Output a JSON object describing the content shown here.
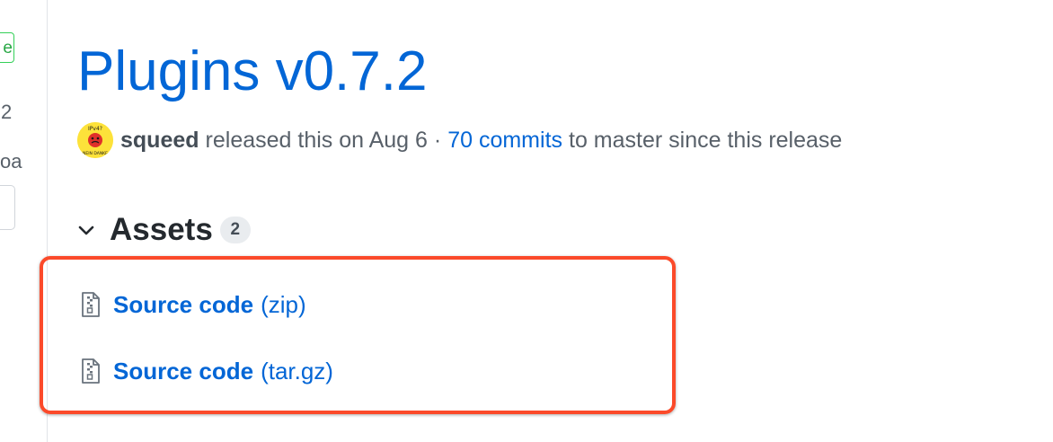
{
  "sidebar": {
    "latest_label": "e",
    "tag_text": "2",
    "commit_text": "oa"
  },
  "release": {
    "title": "Plugins v0.7.2",
    "author": "squeed",
    "released_text": "released this on Aug 6 ·",
    "commits_link": "70 commits",
    "target_text": "to master since this release",
    "avatar_text_top": "IPv4?",
    "avatar_text_bottom": "NEIN DANKE"
  },
  "assets": {
    "title": "Assets",
    "count": "2",
    "items": [
      {
        "name": "Source code",
        "ext": "(zip)"
      },
      {
        "name": "Source code",
        "ext": "(tar.gz)"
      }
    ]
  },
  "colors": {
    "link": "#0366d6",
    "highlight": "#fb4a2a",
    "avatar_bg": "#fde23a"
  },
  "icons": {
    "collapse": "chevron-down-icon",
    "file": "file-zip-icon"
  }
}
